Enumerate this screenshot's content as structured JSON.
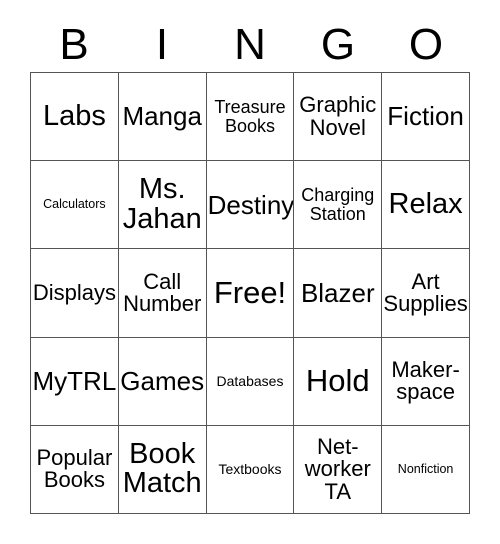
{
  "card": {
    "type": "bingo-card",
    "header_letters": [
      "B",
      "I",
      "N",
      "G",
      "O"
    ],
    "columns": 5,
    "rows": 5,
    "border_color": "#555555",
    "text_color": "#000000",
    "background_color": "#ffffff",
    "free_space": "Free!",
    "cells": [
      {
        "text": "Labs",
        "size": "xl"
      },
      {
        "text": "Manga",
        "size": "lg"
      },
      {
        "text": "Treasure Books",
        "size": "sm"
      },
      {
        "text": "Graphic Novel",
        "size": "md"
      },
      {
        "text": "Fiction",
        "size": "lg"
      },
      {
        "text": "Calculators",
        "size": "xxs"
      },
      {
        "text": "Ms. Jahan",
        "size": "xl"
      },
      {
        "text": "Destiny",
        "size": "lg"
      },
      {
        "text": "Charging Station",
        "size": "sm"
      },
      {
        "text": "Relax",
        "size": "xl"
      },
      {
        "text": "Displays",
        "size": "md"
      },
      {
        "text": "Call Number",
        "size": "md"
      },
      {
        "text": "Free!",
        "size": "xxl"
      },
      {
        "text": "Blazer",
        "size": "lg"
      },
      {
        "text": "Art Supplies",
        "size": "md"
      },
      {
        "text": "MyTRL",
        "size": "lg"
      },
      {
        "text": "Games",
        "size": "lg"
      },
      {
        "text": "Databases",
        "size": "xs"
      },
      {
        "text": "Hold",
        "size": "xxl"
      },
      {
        "text": "Maker-space",
        "size": "md"
      },
      {
        "text": "Popular Books",
        "size": "md"
      },
      {
        "text": "Book Match",
        "size": "xl"
      },
      {
        "text": "Textbooks",
        "size": "xs"
      },
      {
        "text": "Net-worker TA",
        "size": "md"
      },
      {
        "text": "Nonfiction",
        "size": "xxs"
      }
    ]
  }
}
